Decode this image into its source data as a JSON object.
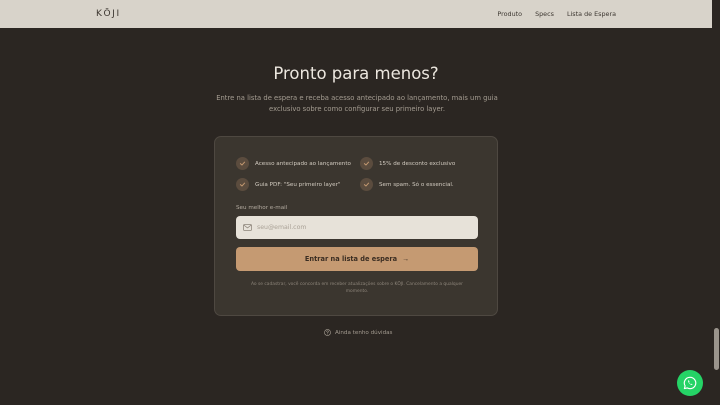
{
  "header": {
    "logo": "KŌJI",
    "nav": [
      "Produto",
      "Specs",
      "Lista de Espera"
    ]
  },
  "hero": {
    "title": "Pronto para menos?",
    "subtitle": "Entre na lista de espera e receba acesso antecipado ao lançamento, mais um guia exclusivo sobre como configurar seu primeiro layer."
  },
  "card": {
    "benefits": [
      "Acesso antecipado ao lançamento",
      "15% de desconto exclusivo",
      "Guia PDF: \"Seu primeiro layer\"",
      "Sem spam. Só o essencial."
    ],
    "email_label": "Seu melhor e-mail",
    "email_placeholder": "seu@email.com",
    "email_value": "",
    "cta_label": "Entrar na lista de espera",
    "cta_arrow": "→",
    "disclaimer": "Ao se cadastrar, você concorda em receber atualizações sobre o KŌJI. Cancelamento a qualquer momento."
  },
  "footer_link": "Ainda tenho dúvidas",
  "colors": {
    "background": "#2b2622",
    "accent": "#c59a72",
    "card": "#3b362f",
    "whatsapp": "#25d366"
  },
  "icons": [
    "check-icon",
    "mail-icon",
    "arrow-right-icon",
    "question-icon",
    "whatsapp-icon"
  ]
}
